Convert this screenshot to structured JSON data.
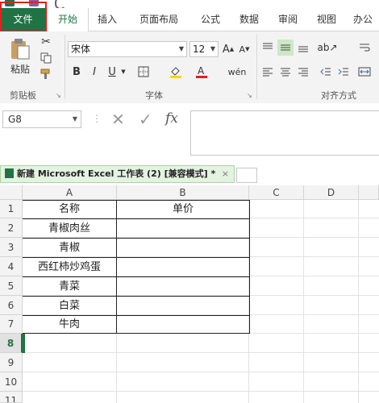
{
  "ribbon_tabs": [
    "文件",
    "开始",
    "插入",
    "页面布局",
    "公式",
    "数据",
    "审阅",
    "视图",
    "办公"
  ],
  "clipboard": {
    "paste_label": "粘贴",
    "group_label": "剪贴板"
  },
  "font": {
    "name": "宋体",
    "size": "12",
    "group_label": "字体",
    "bold": "B",
    "italic": "I",
    "underline": "U"
  },
  "alignment": {
    "group_label": "对齐方式"
  },
  "formula_bar": {
    "name_box": "G8",
    "value": ""
  },
  "document_tab": {
    "title": "新建 Microsoft Excel 工作表 (2)  [兼容模式] *",
    "close": "×"
  },
  "columns": [
    "A",
    "B",
    "C",
    "D"
  ],
  "rows": [
    "1",
    "2",
    "3",
    "4",
    "5",
    "6",
    "7",
    "8",
    "9",
    "10",
    "11"
  ],
  "table": {
    "header": [
      "名称",
      "单价"
    ],
    "items": [
      "青椒肉丝",
      "青椒",
      "西红柿炒鸡蛋",
      "青菜",
      "白菜",
      "牛肉"
    ]
  },
  "colors": {
    "accent": "#217346",
    "highlight": "#e02020"
  }
}
